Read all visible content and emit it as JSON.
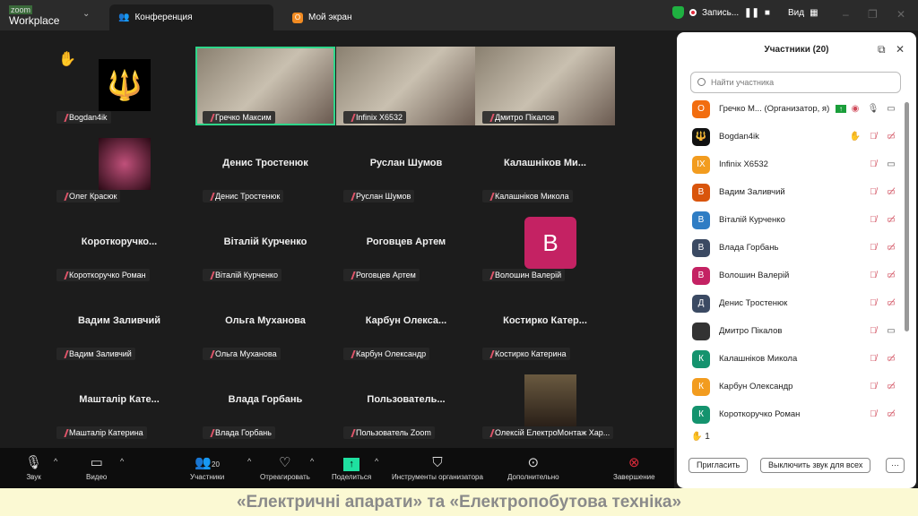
{
  "app": {
    "logo_small": "zoom",
    "logo": "Workplace",
    "tabs": [
      {
        "label": "Конференция"
      },
      {
        "label": "Мой экран"
      }
    ],
    "recording": "Запись...",
    "view": "Вид"
  },
  "tiles": [
    {
      "kind": "hand",
      "label": "Bogdan4ik",
      "avatar": "trident"
    },
    {
      "kind": "video",
      "label": "Гречко Максим",
      "active": true
    },
    {
      "kind": "video",
      "label": "Infinix X6532"
    },
    {
      "kind": "video",
      "label": "Дмитро Пікалов"
    },
    {
      "kind": "img",
      "label": "Олег Красюк"
    },
    {
      "kind": "name",
      "big": "Денис Тростенюк",
      "label": "Денис Тростенюк"
    },
    {
      "kind": "name",
      "big": "Руслан Шумов",
      "label": "Руслан Шумов"
    },
    {
      "kind": "name",
      "big": "Калашніков Ми...",
      "label": "Калашніков Микола"
    },
    {
      "kind": "name",
      "big": "Короткоручко...",
      "label": "Короткоручко Роман"
    },
    {
      "kind": "name",
      "big": "Віталій Курченко",
      "label": "Віталій Курченко"
    },
    {
      "kind": "name",
      "big": "Роговцев Артем",
      "label": "Роговцев Артем"
    },
    {
      "kind": "letter",
      "letter": "В",
      "label": "Волошин Валерій"
    },
    {
      "kind": "name",
      "big": "Вадим Заливчий",
      "label": "Вадим Заливчий"
    },
    {
      "kind": "name",
      "big": "Ольга Муханова",
      "label": "Ольга Муханова"
    },
    {
      "kind": "name",
      "big": "Карбун Олекса...",
      "label": "Карбун Олександр"
    },
    {
      "kind": "name",
      "big": "Костирко Катер...",
      "label": "Костирко Катерина"
    },
    {
      "kind": "name",
      "big": "Машталір Кате...",
      "label": "Машталір Катерина"
    },
    {
      "kind": "name",
      "big": "Влада Горбань",
      "label": "Влада Горбань"
    },
    {
      "kind": "name",
      "big": "Пользователь...",
      "label": "Пользователь Zoom"
    },
    {
      "kind": "photo",
      "label": "Олексій ЕлектроМонтаж Хар..."
    }
  ],
  "toolbar": {
    "audio": "Звук",
    "video": "Видео",
    "participants": "Участники",
    "participants_count": "20",
    "react": "Отреагировать",
    "share": "Поделиться",
    "host_tools": "Инструменты организатора",
    "more": "Дополнительно",
    "end": "Завершение"
  },
  "panel": {
    "title": "Участники (20)",
    "search_placeholder": "Найти участника",
    "raised_hands": "1",
    "invite": "Пригласить",
    "mute_all": "Выключить звук для всех",
    "participants": [
      {
        "name": "Гречко М... (Организатор, я)",
        "initial": "О",
        "color": "#f26d0f",
        "status": "host"
      },
      {
        "name": "Bogdan4ik",
        "initial": "🔱",
        "color": "#111",
        "status": "hand"
      },
      {
        "name": "Infinix X6532",
        "initial": "IX",
        "color": "#f29c1f",
        "status": "camon"
      },
      {
        "name": "Вадим Заливчий",
        "initial": "В",
        "color": "#d9550c",
        "status": "muted"
      },
      {
        "name": "Віталій Курченко",
        "initial": "В",
        "color": "#2f7dc4",
        "status": "muted"
      },
      {
        "name": "Влада Горбань",
        "initial": "В",
        "color": "#3b4a63",
        "status": "muted"
      },
      {
        "name": "Волошин Валерій",
        "initial": "В",
        "color": "#c42263",
        "status": "muted"
      },
      {
        "name": "Денис Тростенюк",
        "initial": "Д",
        "color": "#3b4a63",
        "status": "muted"
      },
      {
        "name": "Дмитро Пікалов",
        "initial": "",
        "color": "#333",
        "status": "camon"
      },
      {
        "name": "Калашніков Микола",
        "initial": "К",
        "color": "#14936e",
        "status": "muted"
      },
      {
        "name": "Карбун Олександр",
        "initial": "К",
        "color": "#f29c1f",
        "status": "muted"
      },
      {
        "name": "Короткоручко Роман",
        "initial": "К",
        "color": "#14936e",
        "status": "muted"
      }
    ]
  },
  "banner": "«Електричні апарати» та «Електропобутова техніка»"
}
